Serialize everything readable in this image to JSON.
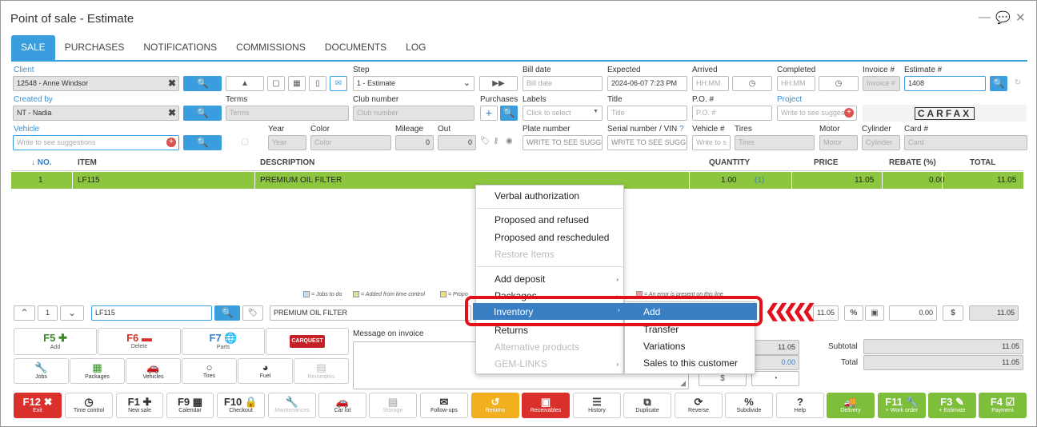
{
  "window": {
    "title": "Point of sale - Estimate"
  },
  "tabs": [
    "SALE",
    "PURCHASES",
    "NOTIFICATIONS",
    "COMMISSIONS",
    "DOCUMENTS",
    "LOG"
  ],
  "form": {
    "client_label": "Client",
    "client_value": "12548 - Anne Windsor",
    "step_label": "Step",
    "step_value": "1 - Estimate",
    "bill_date_label": "Bill date",
    "bill_date_placeholder": "Bill date",
    "expected_label": "Expected",
    "expected_value": "2024-06-07 7:23 PM",
    "arrived_label": "Arrived",
    "arrived_placeholder": "HH:MM",
    "completed_label": "Completed",
    "completed_placeholder": "HH:MM",
    "invoice_label": "Invoice #",
    "invoice_placeholder": "Invoice #",
    "estimate_label": "Estimate #",
    "estimate_value": "1408",
    "created_by_label": "Created by",
    "created_by_value": "NT - Nadia",
    "terms_label": "Terms",
    "terms_placeholder": "Terms",
    "club_label": "Club number",
    "club_placeholder": "Club number",
    "purchases_label": "Purchases",
    "labels_label": "Labels",
    "labels_placeholder": "Click to select",
    "title_label": "Title",
    "title_placeholder": "Title",
    "po_label": "P.O. #",
    "po_placeholder": "P.O. #",
    "project_label": "Project",
    "project_placeholder": "Write to see sugges",
    "carfax": "CARFAX",
    "vehicle_label": "Vehicle",
    "vehicle_placeholder": "Write to see suggestions",
    "year_label": "Year",
    "year_placeholder": "Year",
    "color_label": "Color",
    "color_placeholder": "Color",
    "mileage_label": "Mileage",
    "mileage_value": "0",
    "out_label": "Out",
    "out_value": "0",
    "plate_label": "Plate number",
    "plate_placeholder": "WRITE TO SEE SUGGES",
    "serial_label": "Serial number / VIN",
    "serial_placeholder": "WRITE TO SEE SUGGES",
    "vehicleno_label": "Vehicle #",
    "vehicleno_placeholder": "Write to s",
    "tires_label": "Tires",
    "tires_placeholder": "Tires",
    "motor_label": "Motor",
    "motor_placeholder": "Motor",
    "cylinder_label": "Cylinder",
    "cylinder_placeholder": "Cylinder",
    "card_label": "Card #",
    "card_placeholder": "Card"
  },
  "table": {
    "headers": {
      "no": "↓ NO.",
      "item": "ITEM",
      "description": "DESCRIPTION",
      "quantity": "QUANTITY",
      "price": "PRICE",
      "rebate": "REBATE (%)",
      "total": "TOTAL"
    },
    "rows": [
      {
        "no": "1",
        "item": "LF115",
        "description": "PREMIUM OIL FILTER",
        "quantity": "1.00",
        "qty_count": "(1)",
        "price": "11.05",
        "rebate": "0.00",
        "total": "11.05"
      }
    ]
  },
  "legend": [
    "= Jobs to do",
    "= Added from time control",
    "= Propo",
    "= An error is present on this line"
  ],
  "colors": {
    "accent": "#3a9ddd",
    "row_green": "#8cc63f",
    "highlight": "#3a7fc4",
    "annotation_red": "#e2101a"
  },
  "editor": {
    "line_number": "1",
    "item": "LF115",
    "description": "PREMIUM OIL FILTER",
    "price": "11.05",
    "percent": "%",
    "rebate": "0.00",
    "dollar": "$",
    "total": "11.05"
  },
  "fkeys": [
    {
      "key": "F5",
      "sub": "Add"
    },
    {
      "key": "F6",
      "sub": "Delete"
    },
    {
      "key": "F7",
      "sub": "Parts"
    }
  ],
  "carquest": "CARQUEST",
  "shortcuts": [
    "Jobs",
    "Packages",
    "Vehicles",
    "Tires",
    "Fuel",
    "Reminders"
  ],
  "message": {
    "label": "Message on invoice"
  },
  "totals": {
    "val1": "11.05",
    "val2": "0.00",
    "subtotal_label": "Subtotal",
    "subtotal": "11.05",
    "total_label": "Total",
    "total": "11.05"
  },
  "bottom": [
    {
      "key": "F12",
      "sub": "Exit"
    },
    {
      "key": "",
      "sub": "Time control"
    },
    {
      "key": "F1",
      "sub": "New sale"
    },
    {
      "key": "F9",
      "sub": "Calendar"
    },
    {
      "key": "F10",
      "sub": "Checkout"
    },
    {
      "key": "",
      "sub": "Maintenances"
    },
    {
      "key": "",
      "sub": "Car lot"
    },
    {
      "key": "",
      "sub": "Storage"
    },
    {
      "key": "",
      "sub": "Follow-ups"
    },
    {
      "key": "",
      "sub": "Returns"
    },
    {
      "key": "",
      "sub": "Receivables"
    },
    {
      "key": "",
      "sub": "History"
    },
    {
      "key": "",
      "sub": "Duplicate"
    },
    {
      "key": "",
      "sub": "Reverse"
    },
    {
      "key": "",
      "sub": "Subdivide"
    },
    {
      "key": "",
      "sub": "Help"
    },
    {
      "key": "",
      "sub": "Delivery"
    },
    {
      "key": "F11",
      "sub": "+ Work order"
    },
    {
      "key": "F3",
      "sub": "+ Estimate"
    },
    {
      "key": "F4",
      "sub": "Payment"
    }
  ],
  "context_menu": {
    "items": [
      "Verbal authorization",
      "Proposed and refused",
      "Proposed and rescheduled",
      "Restore Items",
      "Add deposit",
      "Packages",
      "Inventory",
      "Returns",
      "Alternative products",
      "GEM-LINKS"
    ],
    "submenu": [
      "Add",
      "Transfer",
      "Variations",
      "Sales to this customer"
    ]
  }
}
